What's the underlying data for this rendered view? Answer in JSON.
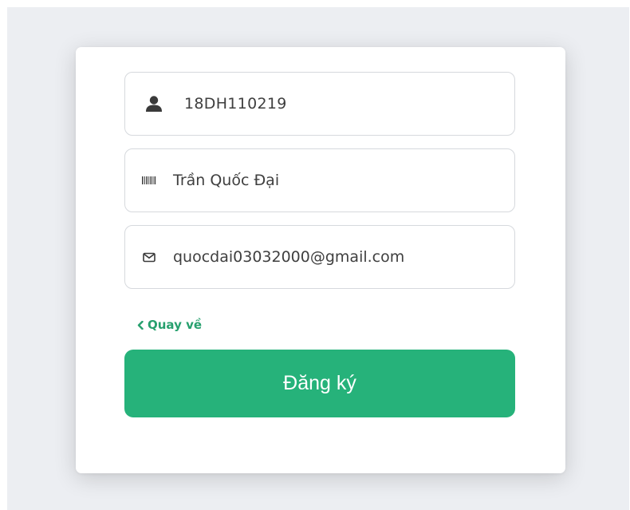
{
  "form": {
    "fields": [
      {
        "icon": "user-icon",
        "value": "18DH110219"
      },
      {
        "icon": "barcode-icon",
        "value": "Trần Quốc Đại"
      },
      {
        "icon": "envelope-icon",
        "value": "quocdai03032000@gmail.com"
      }
    ],
    "back_link": {
      "icon": "chevron-left-icon",
      "label": "Quay về"
    },
    "submit_label": "Đăng ký"
  },
  "colors": {
    "accent": "#26b27a",
    "link": "#27a06e",
    "background": "#eceef2",
    "card": "#ffffff",
    "field_border": "#d6d9dd",
    "text": "#3f3f3f"
  }
}
